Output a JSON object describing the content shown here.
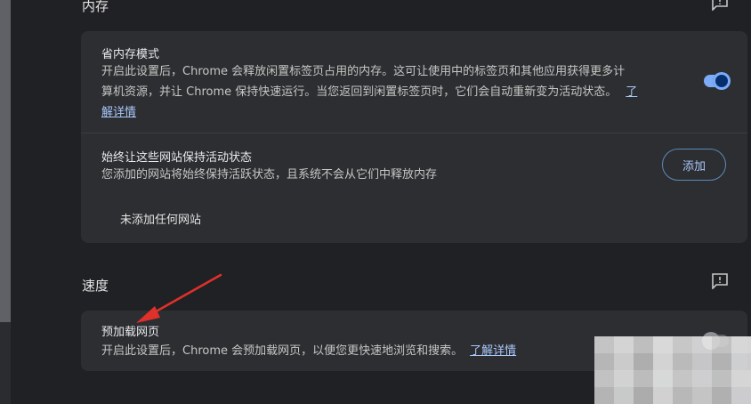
{
  "memory": {
    "section_title": "内存",
    "saver": {
      "title": "省内存模式",
      "desc_line1": "开启此设置后，Chrome 会释放闲置标签页占用的内存。这可让使用中的标签页和其他应用获得更多计",
      "desc_line2": "算机资源，并让 Chrome 保持快速运行。当您返回到闲置标签页时，它们会自动重新变为活动状态。",
      "link_part1": "了",
      "link_part2": "解详情",
      "enabled": true
    },
    "always_active": {
      "title": "始终让这些网站保持活动状态",
      "desc": "您添加的网站将始终保持活跃状态，且系统不会从它们中释放内存",
      "add_label": "添加",
      "empty_message": "未添加任何网站"
    }
  },
  "speed": {
    "section_title": "速度",
    "preload": {
      "title": "预加载网页",
      "desc": "开启此设置后，Chrome 会预加载网页，以便您更快速地浏览和搜索。",
      "link": "了解详情",
      "enabled": false
    }
  },
  "colors": {
    "background": "#202124",
    "card": "#2d2e31",
    "accent": "#a8c7fa",
    "annotation_arrow": "#e0302a"
  }
}
